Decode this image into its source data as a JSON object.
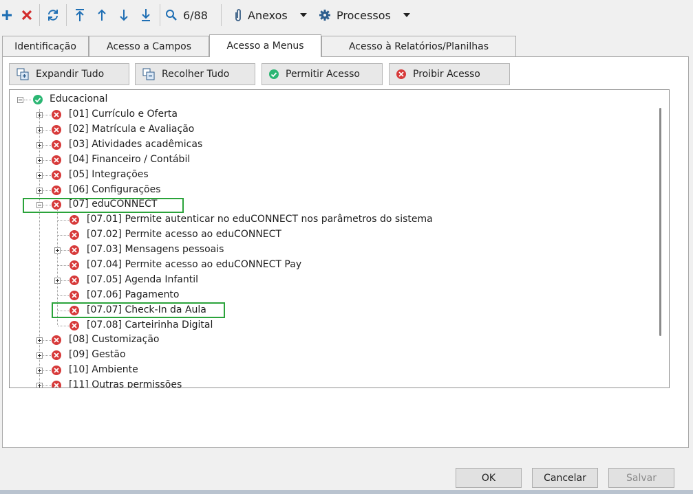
{
  "toolbar": {
    "record_counter": "6/88",
    "anexos_label": "Anexos",
    "processos_label": "Processos"
  },
  "tabs": [
    {
      "label": "Identificação"
    },
    {
      "label": "Acesso a Campos"
    },
    {
      "label": "Acesso a Menus"
    },
    {
      "label": "Acesso à Relatórios/Planilhas"
    }
  ],
  "active_tab": "Acesso a Menus",
  "actions": {
    "expand_label": "Expandir Tudo",
    "collapse_label": "Recolher Tudo",
    "allow_label": "Permitir Acesso",
    "deny_label": "Proibir Acesso"
  },
  "tree": {
    "root_label": "Educacional",
    "items": [
      {
        "label": "[01] Currículo e Oferta",
        "status": "deny",
        "expander": "plus"
      },
      {
        "label": "[02] Matrícula e Avaliação",
        "status": "deny",
        "expander": "plus"
      },
      {
        "label": "[03] Atividades acadêmicas",
        "status": "deny",
        "expander": "plus"
      },
      {
        "label": "[04] Financeiro / Contábil",
        "status": "deny",
        "expander": "plus"
      },
      {
        "label": "[05] Integrações",
        "status": "deny",
        "expander": "plus"
      },
      {
        "label": "[06] Configurações",
        "status": "deny",
        "expander": "plus"
      },
      {
        "label": "[07] eduCONNECT",
        "status": "deny",
        "expander": "minus",
        "highlighted": true
      },
      {
        "label": "[07.01] Permite autenticar no eduCONNECT nos parâmetros do sistema",
        "status": "deny"
      },
      {
        "label": "[07.02] Permite acesso ao eduCONNECT",
        "status": "deny"
      },
      {
        "label": "[07.03] Mensagens pessoais",
        "status": "deny",
        "expander": "plus"
      },
      {
        "label": "[07.04] Permite acesso ao eduCONNECT Pay",
        "status": "deny"
      },
      {
        "label": "[07.05] Agenda Infantil",
        "status": "deny",
        "expander": "plus"
      },
      {
        "label": "[07.06] Pagamento",
        "status": "deny"
      },
      {
        "label": "[07.07] Check-In da Aula",
        "status": "deny",
        "highlighted": true
      },
      {
        "label": "[07.08] Carteirinha Digital",
        "status": "deny"
      },
      {
        "label": "[08] Customização",
        "status": "deny",
        "expander": "plus"
      },
      {
        "label": "[09] Gestão",
        "status": "deny",
        "expander": "plus"
      },
      {
        "label": "[10] Ambiente",
        "status": "deny",
        "expander": "plus"
      },
      {
        "label": "[11] Outras permissões",
        "status": "deny",
        "expander": "plus"
      }
    ]
  },
  "footer": {
    "ok_label": "OK",
    "cancel_label": "Cancelar",
    "save_label": "Salvar"
  },
  "colors": {
    "deny": "#d73a3a",
    "allow": "#2bb673",
    "highlight": "#2aa33a",
    "toolbar_blue": "#1f6fb4",
    "toolbar_red": "#d22c2c"
  }
}
